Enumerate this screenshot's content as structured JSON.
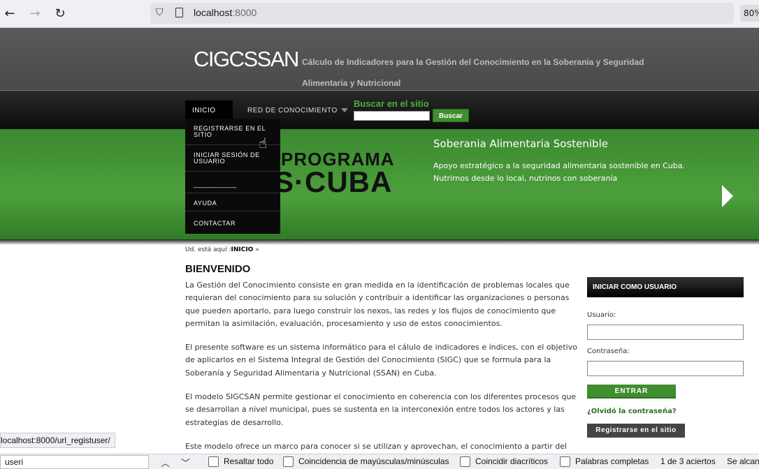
{
  "browser": {
    "url_host": "localhost",
    "url_port": ":8000",
    "zoom": "80%"
  },
  "site": {
    "logo": "CIGCSSAN",
    "tagline": "Cálculo de Indicadores para la Gestión del Conocimiento en la Soberania y Seguridad Alimentaria y Nutricional"
  },
  "nav": {
    "inicio": "INICIO",
    "red": "RED DE CONOCIMIENTO",
    "search_label": "Buscar en el sitio",
    "search_btn": "Buscar"
  },
  "dropdown": {
    "items": [
      "REGISTRARSE EN EL SITIO",
      "INICIAR SESIÓN DE USUARIO",
      "___________",
      "AYUDA",
      "CONTACTAR"
    ]
  },
  "banner": {
    "prog": "PROGRAMA",
    "cuba": "S·CUBA",
    "title": "Soberania Alimentaria Sostenible",
    "text": "Apoyo estratégico a la seguridad alimentaria sostenible en Cuba. Nutrirnos desde lo local, nutrinos con soberanía"
  },
  "breadcrumb": {
    "prefix": "Ud. está aquí :",
    "current": "INICIO",
    "suffix": " »"
  },
  "main": {
    "title": "BIENVENIDO",
    "p1": "La Gestión del Conocimiento consiste en gran medida en la identificación de problemas locales que requieran del conocimiento para su solución y contribuir a identificar las organizaciones o personas que pueden aportarlo, para luego construir los nexos, las redes y los flujos de conocimiento que permitan la asimilación, evaluación, procesamiento y uso de estos conocimientos.",
    "p2": "El presente software es un sistema informático para el cálulo de indicadores e índices, con el objetivo de aplicarlos en el Sistema Integral de Gestión del Conocimiento (SIGC) que se formula para la Soberanía y Seguridad Alimentaria y Nutricional (SSAN) en Cuba.",
    "p3": "El modelo SIGCSAN permite gestionar el conocimiento en coherencia con los diferentes procesos que se desarrollan a nivel municipal, pues se sustenta en la interconexión entre todos los actores y las estrategias de desarrollo.",
    "p4": "Este modelo ofrece un marco para conocer si se utilizan y aprovechan, el conocimiento a partir del"
  },
  "login": {
    "header": "INICIAR COMO USUARIO",
    "user_label": "Usuario:",
    "pass_label": "Contraseña:",
    "enter": "ENTRAR",
    "forgot": "¿Olvidó la contraseña?",
    "register": "Registrarse en el sitio"
  },
  "status": {
    "url": "localhost:8000/url_registuser/"
  },
  "findbar": {
    "query": "useri",
    "highlight": "Resaltar todo",
    "case": "Coincidencia de mayúsculas/minúsculas",
    "diacritics": "Coincidir diacríticos",
    "whole": "Palabras completas",
    "count": "1 de 3 aciertos",
    "extra": "Se alcanz"
  }
}
